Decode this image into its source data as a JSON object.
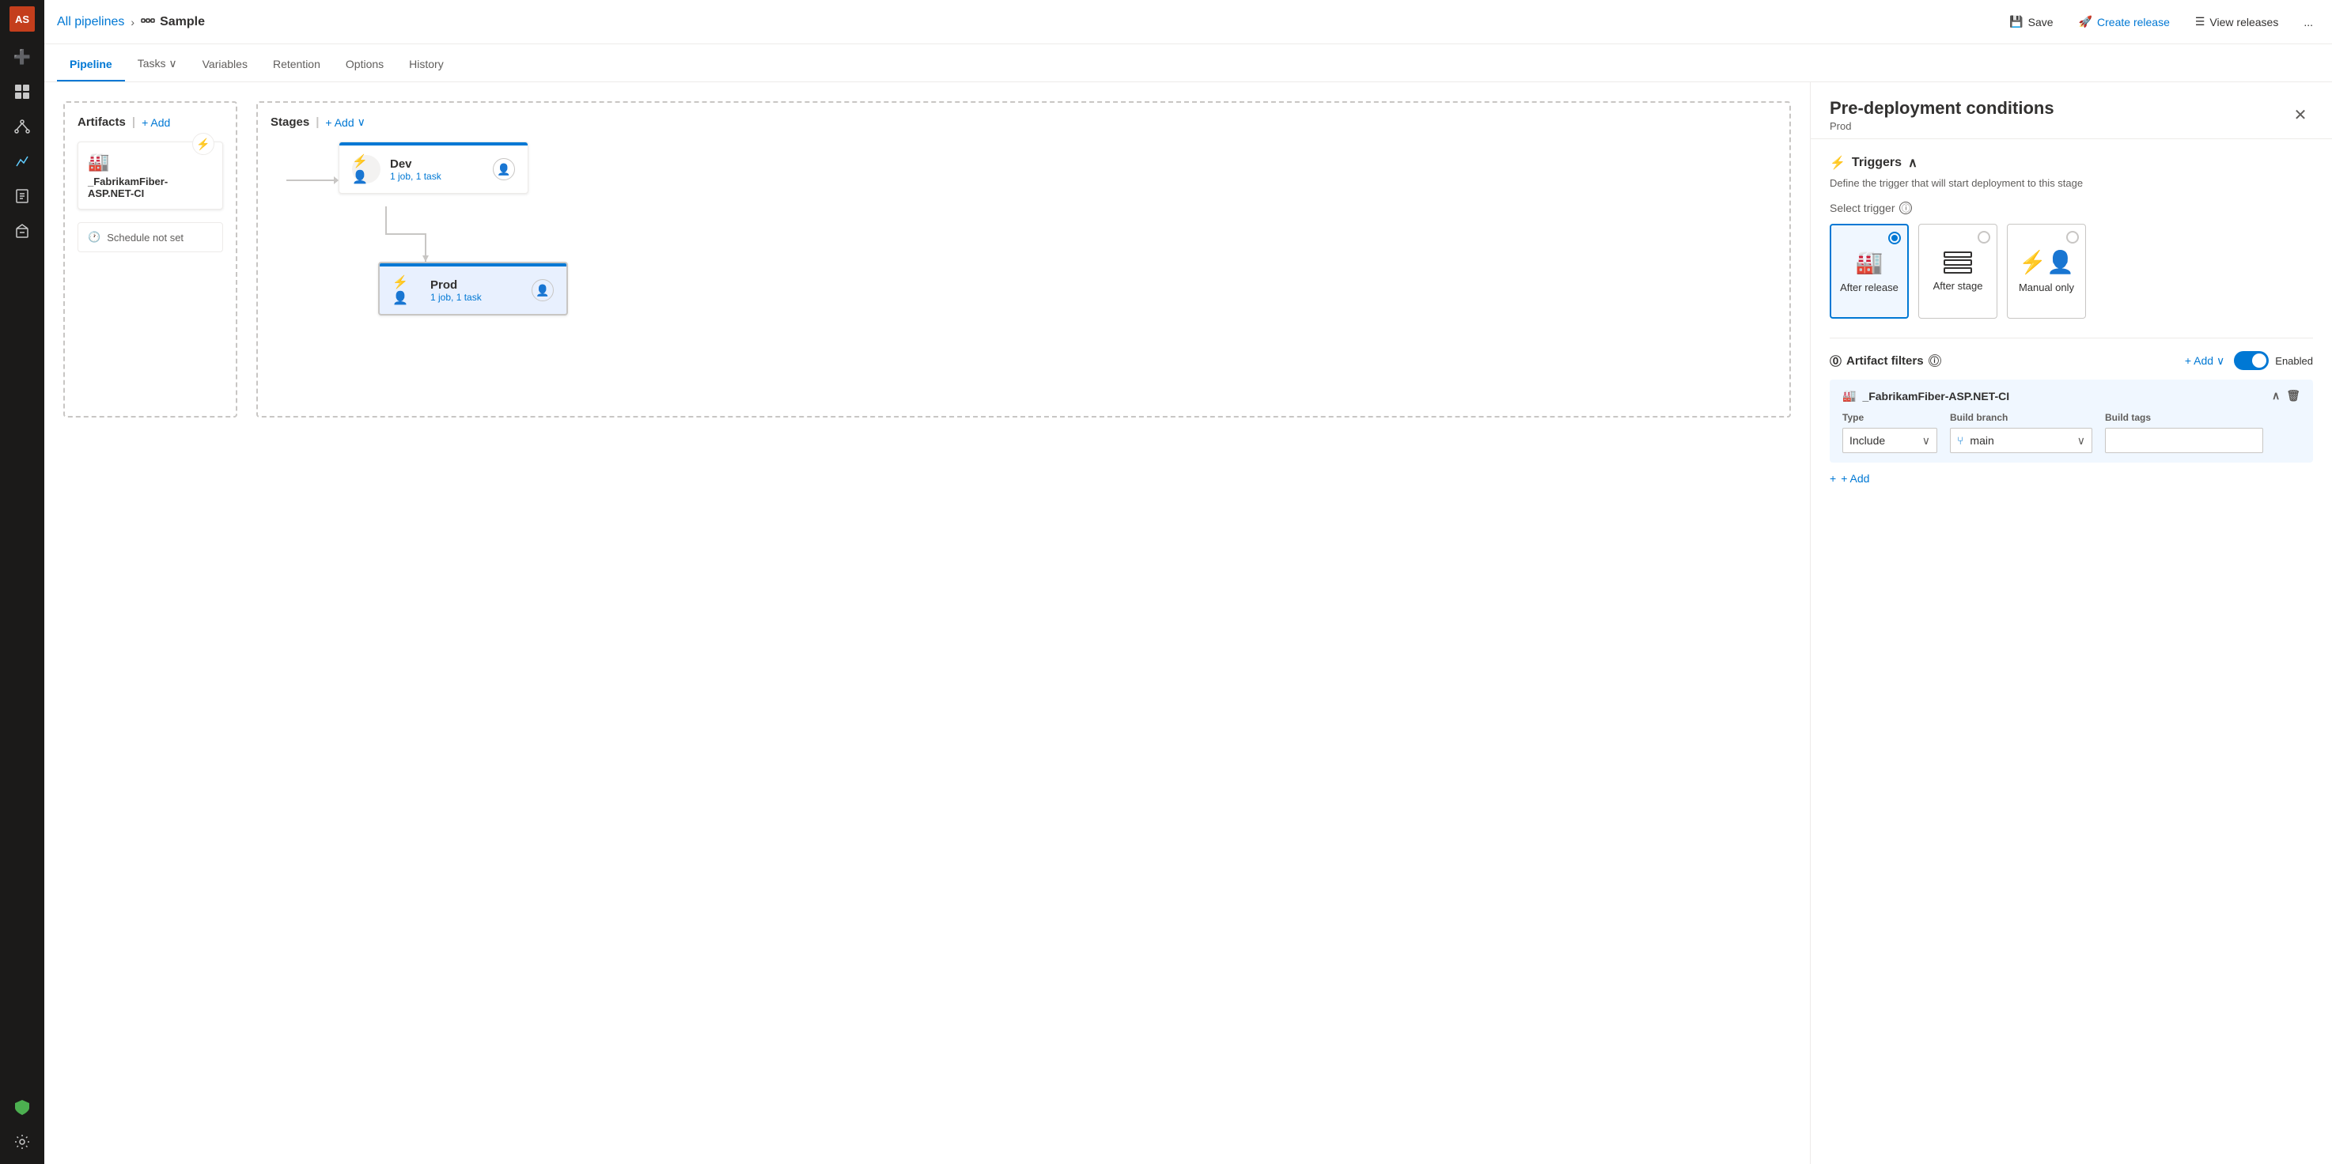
{
  "app": {
    "avatar": "AS"
  },
  "topbar": {
    "breadcrumb_link": "All pipelines",
    "breadcrumb_icon": "⑆",
    "title": "Sample",
    "save_label": "Save",
    "create_release_label": "Create release",
    "view_releases_label": "View releases",
    "more_options": "..."
  },
  "navtabs": {
    "tabs": [
      {
        "id": "pipeline",
        "label": "Pipeline",
        "active": true
      },
      {
        "id": "tasks",
        "label": "Tasks",
        "active": false,
        "has_dropdown": true
      },
      {
        "id": "variables",
        "label": "Variables",
        "active": false
      },
      {
        "id": "retention",
        "label": "Retention",
        "active": false
      },
      {
        "id": "options",
        "label": "Options",
        "active": false
      },
      {
        "id": "history",
        "label": "History",
        "active": false
      }
    ]
  },
  "canvas": {
    "artifacts_header": "Artifacts",
    "artifacts_add": "+ Add",
    "artifact_name": "_FabrikamFiber-ASP.NET-CI",
    "schedule_label": "Schedule not set",
    "stages_header": "Stages",
    "stages_add": "+ Add",
    "stages": [
      {
        "id": "dev",
        "name": "Dev",
        "detail": "1 job, 1 task"
      },
      {
        "id": "prod",
        "name": "Prod",
        "detail": "1 job, 1 task"
      }
    ]
  },
  "right_panel": {
    "title": "Pre-deployment conditions",
    "subtitle": "Prod",
    "triggers_section": "Triggers",
    "triggers_desc": "Define the trigger that will start deployment to this stage",
    "select_trigger_label": "Select trigger",
    "trigger_options": [
      {
        "id": "after_release",
        "label": "After release",
        "selected": true,
        "icon": "🏭"
      },
      {
        "id": "after_stage",
        "label": "After stage",
        "selected": false,
        "icon": "☰"
      },
      {
        "id": "manual_only",
        "label": "Manual only",
        "selected": false,
        "icon": "⚡👤"
      }
    ],
    "artifact_filters_title": "Artifact filters",
    "add_filter_label": "+ Add",
    "toggle_enabled_label": "Enabled",
    "filter_artifact_name": "_FabrikamFiber-ASP.NET-CI",
    "filter_type_label": "Type",
    "filter_branch_label": "Build branch",
    "filter_tags_label": "Build tags",
    "filter_type_value": "Include",
    "filter_branch_value": "main",
    "filter_tags_placeholder": "",
    "add_artifact_label": "+ Add"
  },
  "sidebar": {
    "items": [
      {
        "id": "home",
        "icon": "➕",
        "active": false
      },
      {
        "id": "boards",
        "icon": "▦",
        "active": false
      },
      {
        "id": "repos",
        "icon": "⑂",
        "active": false
      },
      {
        "id": "pipelines",
        "icon": "🚀",
        "active": true,
        "highlighted": true
      },
      {
        "id": "testplans",
        "icon": "📋",
        "active": false
      },
      {
        "id": "artifacts",
        "icon": "📦",
        "active": false
      }
    ],
    "bottom_items": [
      {
        "id": "shield",
        "icon": "🛡",
        "active": false
      },
      {
        "id": "settings",
        "icon": "⚙",
        "active": false
      }
    ]
  }
}
